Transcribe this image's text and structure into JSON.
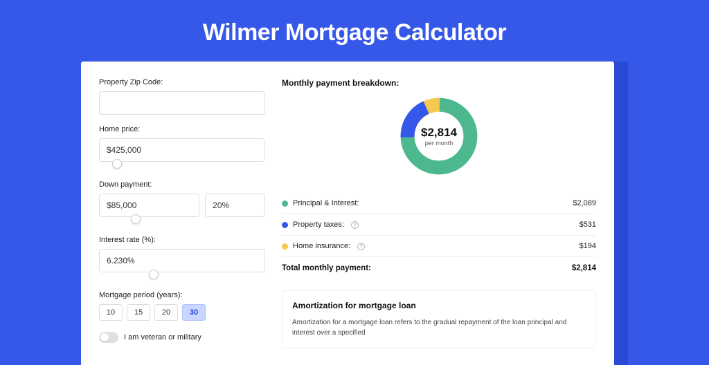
{
  "title": "Wilmer Mortgage Calculator",
  "form": {
    "zip_label": "Property Zip Code:",
    "zip_value": "",
    "home_price_label": "Home price:",
    "home_price_value": "$425,000",
    "down_payment_label": "Down payment:",
    "down_payment_value": "$85,000",
    "down_payment_pct": "20%",
    "interest_label": "Interest rate (%):",
    "interest_value": "6.230%",
    "period_label": "Mortgage period (years):",
    "periods": [
      "10",
      "15",
      "20",
      "30"
    ],
    "period_active": "30",
    "veteran_label": "I am veteran or military"
  },
  "breakdown": {
    "title": "Monthly payment breakdown:",
    "center_value": "$2,814",
    "center_sub": "per month",
    "items": [
      {
        "label": "Principal & Interest:",
        "value": "$2,089",
        "color": "#4db88e"
      },
      {
        "label": "Property taxes:",
        "value": "$531",
        "color": "#3658e8",
        "help": true
      },
      {
        "label": "Home insurance:",
        "value": "$194",
        "color": "#f4c94f",
        "help": true
      }
    ],
    "total_label": "Total monthly payment:",
    "total_value": "$2,814"
  },
  "amortization": {
    "title": "Amortization for mortgage loan",
    "body": "Amortization for a mortgage loan refers to the gradual repayment of the loan principal and interest over a specified"
  },
  "chart_data": {
    "type": "pie",
    "title": "Monthly payment breakdown",
    "series": [
      {
        "name": "Principal & Interest",
        "value": 2089,
        "color": "#4db88e"
      },
      {
        "name": "Property taxes",
        "value": 531,
        "color": "#3658e8"
      },
      {
        "name": "Home insurance",
        "value": 194,
        "color": "#f4c94f"
      }
    ],
    "total": 2814,
    "unit": "USD per month"
  }
}
